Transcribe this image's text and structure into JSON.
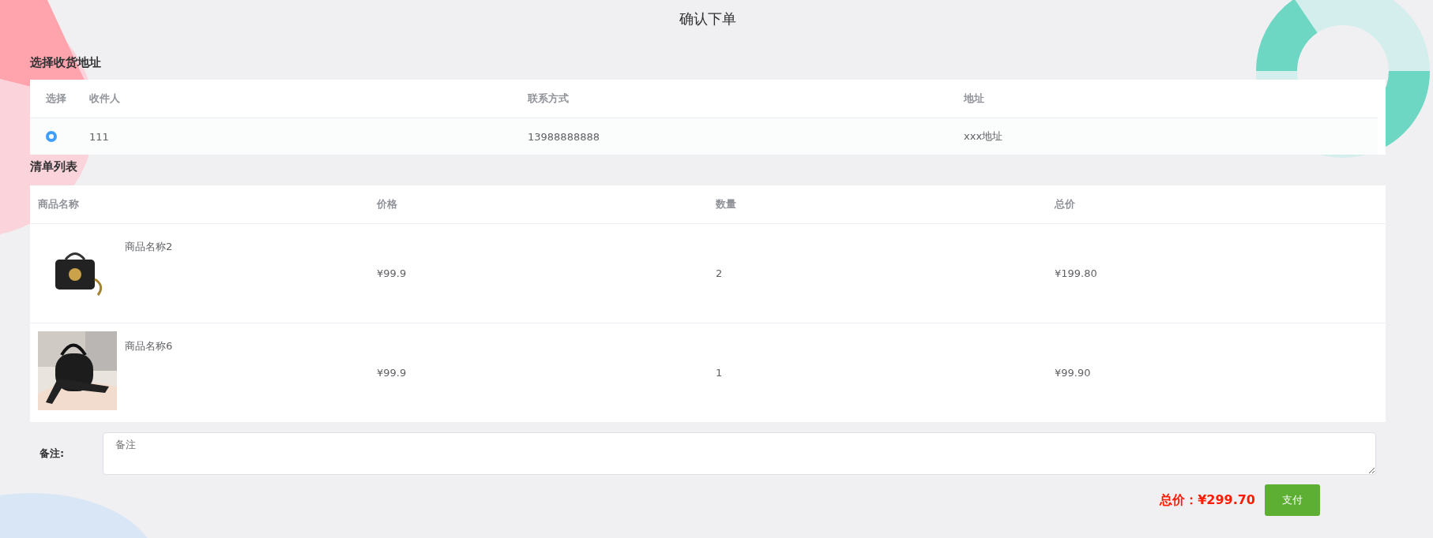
{
  "page_title": "确认下单",
  "address_section": {
    "title": "选择收货地址",
    "columns": [
      "选择",
      "收件人",
      "联系方式",
      "地址"
    ],
    "rows": [
      {
        "selected": true,
        "recipient": "111",
        "phone": "13988888888",
        "address": "xxx地址"
      }
    ]
  },
  "list_section": {
    "title": "清单列表",
    "columns": [
      "商品名称",
      "价格",
      "数量",
      "总价"
    ],
    "rows": [
      {
        "name": "商品名称2",
        "price": "¥99.9",
        "quantity": "2",
        "total": "¥199.80"
      },
      {
        "name": "商品名称6",
        "price": "¥99.9",
        "quantity": "1",
        "total": "¥99.90"
      }
    ]
  },
  "remark": {
    "label": "备注:",
    "placeholder": "备注"
  },
  "total": "总价：¥299.70",
  "pay_button": "支付"
}
